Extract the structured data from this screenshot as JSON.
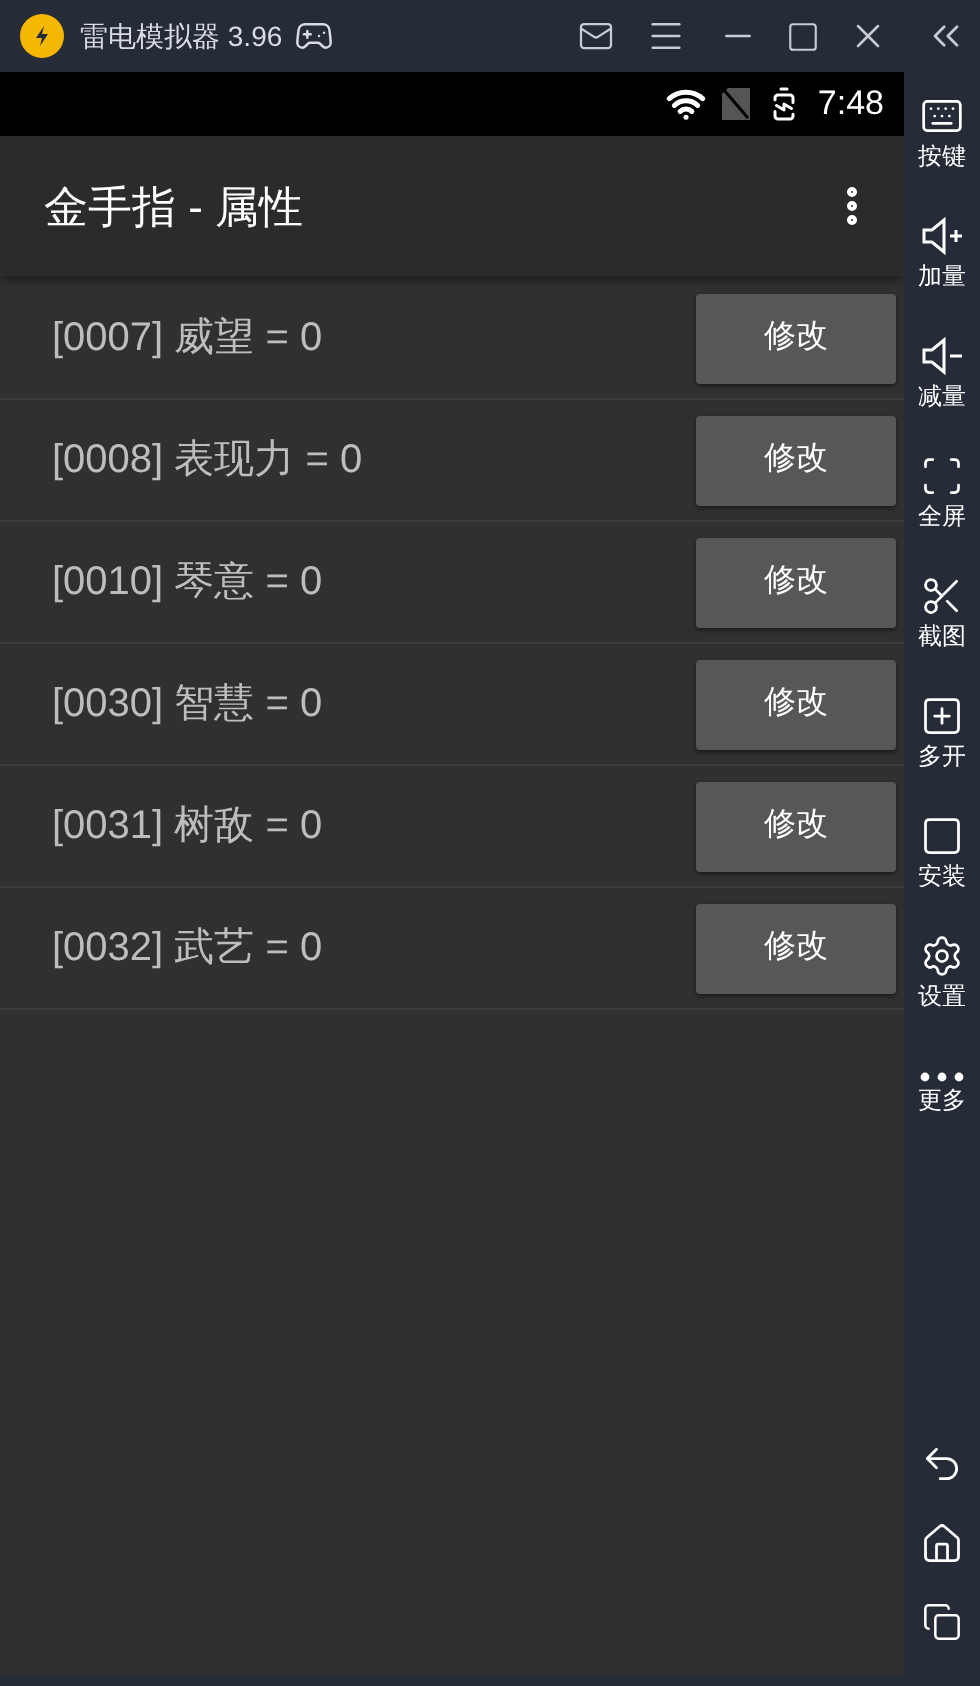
{
  "window": {
    "title": "雷电模拟器 3.96"
  },
  "status_bar": {
    "time": "7:48"
  },
  "app_bar": {
    "title": "金手指 - 属性"
  },
  "rows": [
    {
      "label": "[0007] 威望 = 0",
      "button": "修改"
    },
    {
      "label": "[0008] 表现力 = 0",
      "button": "修改"
    },
    {
      "label": "[0010] 琴意 = 0",
      "button": "修改"
    },
    {
      "label": "[0030] 智慧 = 0",
      "button": "修改"
    },
    {
      "label": "[0031] 树敌 = 0",
      "button": "修改"
    },
    {
      "label": "[0032] 武艺 = 0",
      "button": "修改"
    }
  ],
  "sidebar": {
    "items": [
      {
        "label": "按键"
      },
      {
        "label": "加量"
      },
      {
        "label": "减量"
      },
      {
        "label": "全屏"
      },
      {
        "label": "截图"
      },
      {
        "label": "多开"
      },
      {
        "label": "安装"
      },
      {
        "label": "设置"
      },
      {
        "label": "更多"
      }
    ]
  }
}
